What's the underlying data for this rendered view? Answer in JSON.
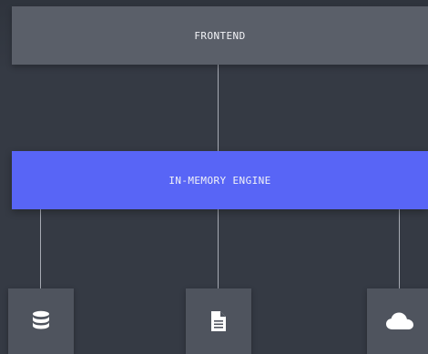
{
  "colors": {
    "background": "#353a44",
    "background_gradient_top": "#2f343d",
    "frontend_box": "#5a5f69",
    "engine_box": "#5865f6",
    "store_box": "#4f545e",
    "connector": "#a7abb4",
    "label": "#f2f3f7",
    "icon": "#ffffff"
  },
  "frontend": {
    "label": "FRONTEND"
  },
  "engine": {
    "label": "IN-MEMORY ENGINE"
  },
  "stores": [
    {
      "icon": "database-icon"
    },
    {
      "icon": "document-icon"
    },
    {
      "icon": "cloud-icon"
    }
  ]
}
